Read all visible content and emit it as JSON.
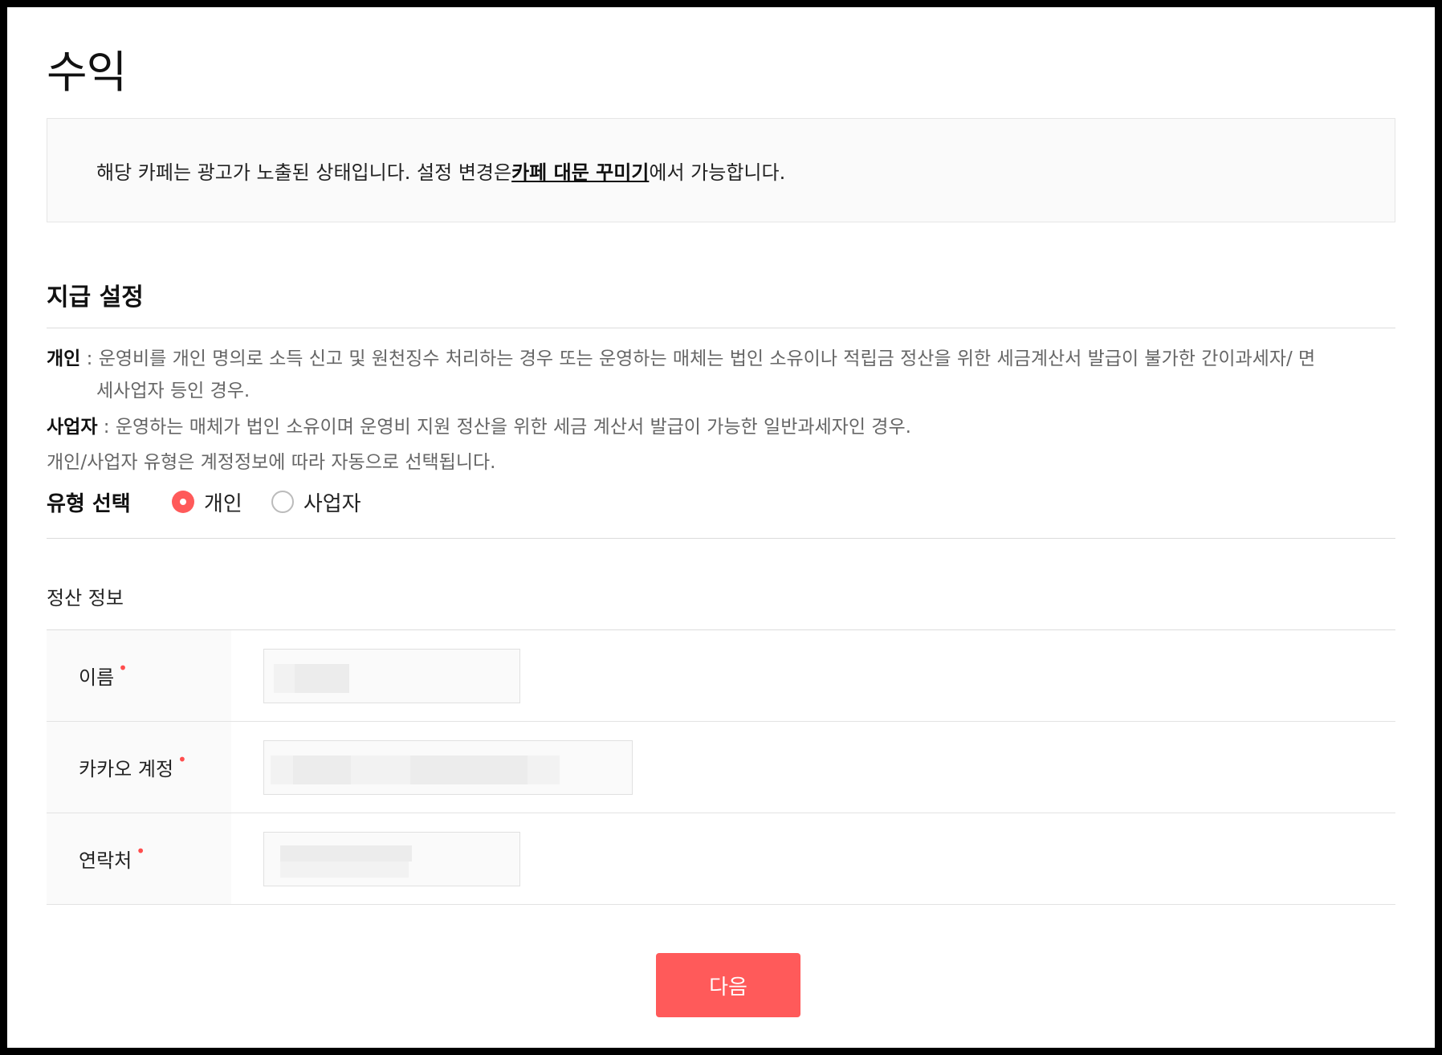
{
  "page": {
    "title": "수익"
  },
  "notice": {
    "text_before": "해당 카페는 광고가 노출된 상태입니다. 설정 변경은 ",
    "link_text": "카페 대문 꾸미기",
    "text_after": "에서 가능합니다."
  },
  "payment": {
    "section_title": "지급 설정",
    "desc_individual_term": "개인",
    "desc_individual_text": " : 운영비를 개인 명의로 소득 신고 및 원천징수 처리하는 경우 또는 운영하는 매체는 법인 소유이나 적립금 정산을 위한 세금계산서 발급이 불가한 간이과세자/ 면",
    "desc_individual_text2": "세사업자 등인 경우.",
    "desc_business_term": "사업자",
    "desc_business_text": " : 운영하는 매체가 법인 소유이며 운영비 지원 정산을 위한 세금 계산서 발급이 가능한 일반과세자인 경우.",
    "desc_auto": "개인/사업자 유형은 계정정보에 따라 자동으로 선택됩니다.",
    "type_label": "유형 선택",
    "type_options": [
      {
        "label": "개인",
        "checked": true
      },
      {
        "label": "사업자",
        "checked": false
      }
    ]
  },
  "settlement": {
    "sub_title": "정산 정보",
    "fields": [
      {
        "label": "이름",
        "required": "•"
      },
      {
        "label": "카카오 계정",
        "required": "•"
      },
      {
        "label": "연락처",
        "required": "•"
      }
    ]
  },
  "actions": {
    "next_label": "다음"
  },
  "colors": {
    "accent": "#ff5a5a",
    "required": "#ff4d4d"
  }
}
